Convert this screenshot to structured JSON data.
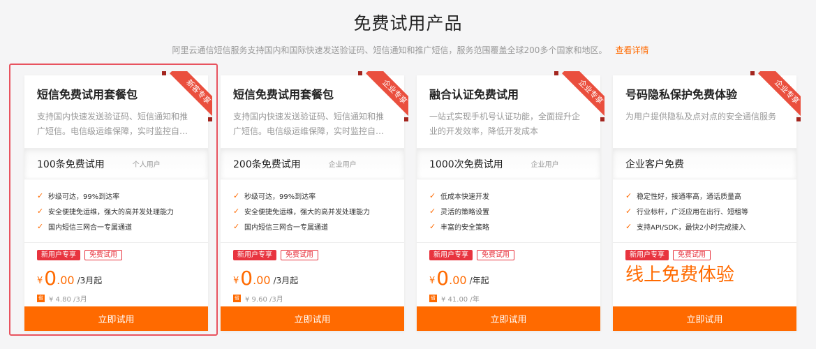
{
  "header": {
    "title": "免费试用产品",
    "subtitle": "阿里云通信短信服务支持国内和国际快速发送验证码、短信通知和推广短信，服务范围覆盖全球200多个国家和地区。",
    "detail_link": "查看详情"
  },
  "cards": [
    {
      "ribbon": "新客专享",
      "name": "短信免费试用套餐包",
      "desc": "支持国内快速发送验证码、短信通知和推广短信。电信级运维保障，实时监控自…",
      "band_main": "100条免费试用",
      "band_sub": "个人用户",
      "features": [
        "秒级可达，99%到达率",
        "安全便捷免运维，强大的高并发处理能力",
        "国内短信三网合一专属通道"
      ],
      "tag1": "新用户专享",
      "tag2": "免费试用",
      "currency": "¥",
      "price_int": "0",
      "price_dec": ".00",
      "price_unit": "/3月起",
      "save_icon": "省",
      "original": "¥ 4.80 /3月",
      "button": "立即试用"
    },
    {
      "ribbon": "企业专享",
      "name": "短信免费试用套餐包",
      "desc": "支持国内快速发送验证码、短信通知和推广短信。电信级运维保障，实时监控自…",
      "band_main": "200条免费试用",
      "band_sub": "企业用户",
      "features": [
        "秒级可达，99%到达率",
        "安全便捷免运维，强大的高并发处理能力",
        "国内短信三网合一专属通道"
      ],
      "tag1": "新用户专享",
      "tag2": "免费试用",
      "currency": "¥",
      "price_int": "0",
      "price_dec": ".00",
      "price_unit": "/3月起",
      "save_icon": "省",
      "original": "¥ 9.60 /3月",
      "button": "立即试用"
    },
    {
      "ribbon": "企业专享",
      "name": "融合认证免费试用",
      "desc": "一站式实现手机号认证功能，全面提升企业的开发效率，降低开发成本",
      "band_main": "1000次免费试用",
      "band_sub": "企业用户",
      "features": [
        "低成本快速开发",
        "灵活的策略设置",
        "丰富的安全策略"
      ],
      "tag1": "新用户专享",
      "tag2": "免费试用",
      "currency": "¥",
      "price_int": "0",
      "price_dec": ".00",
      "price_unit": "/年起",
      "save_icon": "省",
      "original": "¥ 41.00 /年",
      "button": "立即试用"
    },
    {
      "ribbon": "企业专享",
      "name": "号码隐私保护免费体验",
      "desc": "为用户提供隐私及点对点的安全通信服务",
      "band_main": "企业客户免费",
      "band_sub": "",
      "features": [
        "稳定性好，接通率高，通话质量高",
        "行业标杆，广泛应用在出行、短租等",
        "支持API/SDK，最快2小时完成接入"
      ],
      "tag1": "新用户专享",
      "tag2": "免费试用",
      "free_text": "线上免费体验",
      "button": "立即试用"
    }
  ],
  "colors": {
    "accent": "#ff6a00",
    "ribbon": "#ea4f3e",
    "tag": "#e8343f",
    "highlight_border": "#e8535f"
  }
}
